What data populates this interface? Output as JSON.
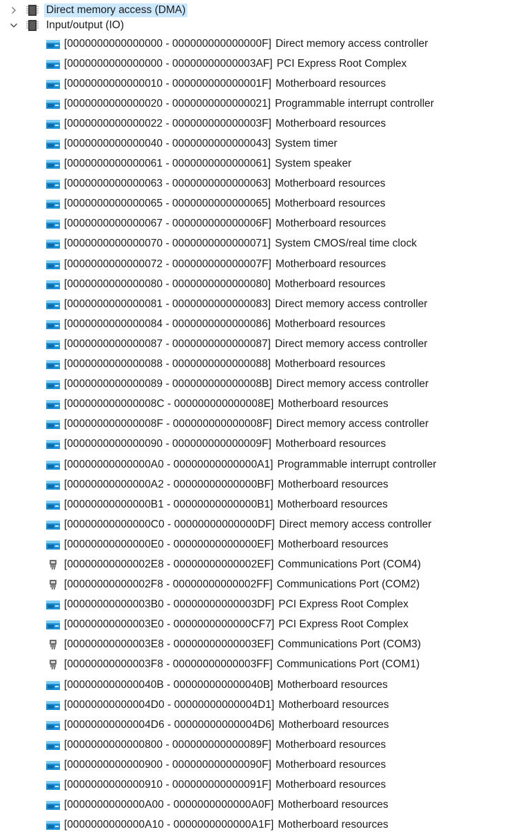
{
  "tree": {
    "roots": [
      {
        "label": "Direct memory access (DMA)",
        "expanded": false,
        "selected": true,
        "icon": "chip-icon"
      },
      {
        "label": "Input/output (IO)",
        "expanded": true,
        "selected": false,
        "icon": "chip-icon"
      }
    ],
    "io_items": [
      {
        "range": "[0000000000000000 - 000000000000000F]",
        "desc": "Direct memory access controller",
        "icon": "device-icon"
      },
      {
        "range": "[0000000000000000 - 00000000000003AF]",
        "desc": "PCI Express Root Complex",
        "icon": "device-icon"
      },
      {
        "range": "[0000000000000010 - 000000000000001F]",
        "desc": "Motherboard resources",
        "icon": "device-icon"
      },
      {
        "range": "[0000000000000020 - 0000000000000021]",
        "desc": "Programmable interrupt controller",
        "icon": "device-icon"
      },
      {
        "range": "[0000000000000022 - 000000000000003F]",
        "desc": "Motherboard resources",
        "icon": "device-icon"
      },
      {
        "range": "[0000000000000040 - 0000000000000043]",
        "desc": "System timer",
        "icon": "device-icon"
      },
      {
        "range": "[0000000000000061 - 0000000000000061]",
        "desc": "System speaker",
        "icon": "device-icon"
      },
      {
        "range": "[0000000000000063 - 0000000000000063]",
        "desc": "Motherboard resources",
        "icon": "device-icon"
      },
      {
        "range": "[0000000000000065 - 0000000000000065]",
        "desc": "Motherboard resources",
        "icon": "device-icon"
      },
      {
        "range": "[0000000000000067 - 000000000000006F]",
        "desc": "Motherboard resources",
        "icon": "device-icon"
      },
      {
        "range": "[0000000000000070 - 0000000000000071]",
        "desc": "System CMOS/real time clock",
        "icon": "device-icon"
      },
      {
        "range": "[0000000000000072 - 000000000000007F]",
        "desc": "Motherboard resources",
        "icon": "device-icon"
      },
      {
        "range": "[0000000000000080 - 0000000000000080]",
        "desc": "Motherboard resources",
        "icon": "device-icon"
      },
      {
        "range": "[0000000000000081 - 0000000000000083]",
        "desc": "Direct memory access controller",
        "icon": "device-icon"
      },
      {
        "range": "[0000000000000084 - 0000000000000086]",
        "desc": "Motherboard resources",
        "icon": "device-icon"
      },
      {
        "range": "[0000000000000087 - 0000000000000087]",
        "desc": "Direct memory access controller",
        "icon": "device-icon"
      },
      {
        "range": "[0000000000000088 - 0000000000000088]",
        "desc": "Motherboard resources",
        "icon": "device-icon"
      },
      {
        "range": "[0000000000000089 - 000000000000008B]",
        "desc": "Direct memory access controller",
        "icon": "device-icon"
      },
      {
        "range": "[000000000000008C - 000000000000008E]",
        "desc": "Motherboard resources",
        "icon": "device-icon"
      },
      {
        "range": "[000000000000008F - 000000000000008F]",
        "desc": "Direct memory access controller",
        "icon": "device-icon"
      },
      {
        "range": "[0000000000000090 - 000000000000009F]",
        "desc": "Motherboard resources",
        "icon": "device-icon"
      },
      {
        "range": "[00000000000000A0 - 00000000000000A1]",
        "desc": "Programmable interrupt controller",
        "icon": "device-icon"
      },
      {
        "range": "[00000000000000A2 - 00000000000000BF]",
        "desc": "Motherboard resources",
        "icon": "device-icon"
      },
      {
        "range": "[00000000000000B1 - 00000000000000B1]",
        "desc": "Motherboard resources",
        "icon": "device-icon"
      },
      {
        "range": "[00000000000000C0 - 00000000000000DF]",
        "desc": "Direct memory access controller",
        "icon": "device-icon"
      },
      {
        "range": "[00000000000000E0 - 00000000000000EF]",
        "desc": "Motherboard resources",
        "icon": "device-icon"
      },
      {
        "range": "[00000000000002E8 - 00000000000002EF]",
        "desc": "Communications Port (COM4)",
        "icon": "port-icon"
      },
      {
        "range": "[00000000000002F8 - 00000000000002FF]",
        "desc": "Communications Port (COM2)",
        "icon": "port-icon"
      },
      {
        "range": "[00000000000003B0 - 00000000000003DF]",
        "desc": "PCI Express Root Complex",
        "icon": "device-icon"
      },
      {
        "range": "[00000000000003E0 - 0000000000000CF7]",
        "desc": "PCI Express Root Complex",
        "icon": "device-icon"
      },
      {
        "range": "[00000000000003E8 - 00000000000003EF]",
        "desc": "Communications Port (COM3)",
        "icon": "port-icon"
      },
      {
        "range": "[00000000000003F8 - 00000000000003FF]",
        "desc": "Communications Port (COM1)",
        "icon": "port-icon"
      },
      {
        "range": "[000000000000040B - 000000000000040B]",
        "desc": "Motherboard resources",
        "icon": "device-icon"
      },
      {
        "range": "[00000000000004D0 - 00000000000004D1]",
        "desc": "Motherboard resources",
        "icon": "device-icon"
      },
      {
        "range": "[00000000000004D6 - 00000000000004D6]",
        "desc": "Motherboard resources",
        "icon": "device-icon"
      },
      {
        "range": "[0000000000000800 - 000000000000089F]",
        "desc": "Motherboard resources",
        "icon": "device-icon"
      },
      {
        "range": "[0000000000000900 - 000000000000090F]",
        "desc": "Motherboard resources",
        "icon": "device-icon"
      },
      {
        "range": "[0000000000000910 - 000000000000091F]",
        "desc": "Motherboard resources",
        "icon": "device-icon"
      },
      {
        "range": "[0000000000000A00 - 0000000000000A0F]",
        "desc": "Motherboard resources",
        "icon": "device-icon"
      },
      {
        "range": "[0000000000000A10 - 0000000000000A1F]",
        "desc": "Motherboard resources",
        "icon": "device-icon"
      }
    ]
  },
  "colors": {
    "selection": "#cce8ff",
    "text": "#1a1a1a",
    "device_icon_body": "#1e90d6",
    "device_icon_accent": "#7ecbf2",
    "port_icon": "#6b6b6b"
  }
}
